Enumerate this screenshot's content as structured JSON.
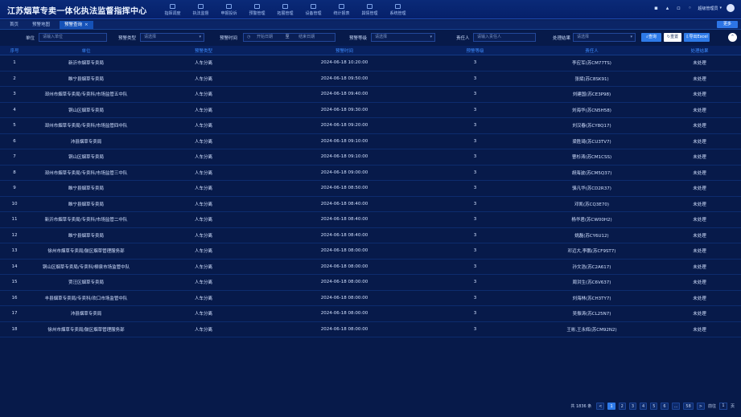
{
  "app": {
    "title": "江苏烟草专卖一体化执法监督指挥中心"
  },
  "topnav": [
    {
      "label": "指挥调度",
      "icon": "dispatch-icon"
    },
    {
      "label": "执法监督",
      "icon": "law-enforcement-icon"
    },
    {
      "label": "申报投诉",
      "icon": "complaint-icon"
    },
    {
      "label": "预警管理",
      "icon": "warning-icon"
    },
    {
      "label": "拓展管理",
      "icon": "extension-icon"
    },
    {
      "label": "设备管理",
      "icon": "device-icon"
    },
    {
      "label": "统计报表",
      "icon": "report-icon"
    },
    {
      "label": "舆情管理",
      "icon": "opinion-icon"
    },
    {
      "label": "系统管理",
      "icon": "system-icon"
    }
  ],
  "header": {
    "user_name": "超级管理员"
  },
  "tabs": [
    {
      "label": "首页"
    },
    {
      "label": "预警地图"
    },
    {
      "label": "预警查询",
      "close": "×"
    }
  ],
  "more_button": "更多",
  "filters": {
    "unit_label": "单位",
    "unit_placeholder": "请输入单位",
    "type_label": "预警类型",
    "type_placeholder": "请选择",
    "time_label": "预警时间",
    "start_placeholder": "开始日期",
    "range_sep": "至",
    "end_placeholder": "结束日期",
    "level_label": "预警等级",
    "level_placeholder": "请选择",
    "person_label": "责任人",
    "person_placeholder": "请输入责任人",
    "result_label": "处理结果",
    "result_placeholder": "请选择",
    "search_label": "查询",
    "reset_label": "重置",
    "export_label": "导出Excel",
    "collapse_label": "^"
  },
  "table": {
    "columns": [
      "序号",
      "单位",
      "预警类型",
      "预警时间",
      "预警等级",
      "责任人",
      "处理结果"
    ],
    "rows": [
      [
        "1",
        "新沂市烟草专卖局",
        "人车分离",
        "2024-06-18 10:20:00",
        "3",
        "李应军(苏CM77TS)",
        "未处理"
      ],
      [
        "2",
        "睢宁县烟草专卖局",
        "人车分离",
        "2024-06-18 09:50:00",
        "3",
        "张斌(苏C8SK91)",
        "未处理"
      ],
      [
        "3",
        "邳州市烟草专卖局/专卖科/市场监管五中队",
        "人车分离",
        "2024-06-18 09:40:00",
        "3",
        "刘建国(苏CE3P98)",
        "未处理"
      ],
      [
        "4",
        "铜山区烟草专卖局",
        "人车分离",
        "2024-06-18 09:30:00",
        "3",
        "刘海华(苏CN5H58)",
        "未处理"
      ],
      [
        "5",
        "邳州市烟草专卖局/专卖科/市场监管四中队",
        "人车分离",
        "2024-06-18 09:20:00",
        "3",
        "刘汉春(苏CY8Q17)",
        "未处理"
      ],
      [
        "6",
        "沛县烟草专卖局",
        "人车分离",
        "2024-06-18 09:10:00",
        "3",
        "梁胜琦(苏CU3TV7)",
        "未处理"
      ],
      [
        "7",
        "铜山区烟草专卖局",
        "人车分离",
        "2024-06-18 09:10:00",
        "3",
        "曹杉涛(苏CM1CSS)",
        "未处理"
      ],
      [
        "8",
        "邳州市烟草专卖局/专卖科/市场监管三中队",
        "人车分离",
        "2024-06-18 09:00:00",
        "3",
        "胡海波(苏CM5Q37)",
        "未处理"
      ],
      [
        "9",
        "睢宁县烟草专卖局",
        "人车分离",
        "2024-06-18 08:50:00",
        "3",
        "骆凡华(苏CD2R37)",
        "未处理"
      ],
      [
        "10",
        "睢宁县烟草专卖局",
        "人车分离",
        "2024-06-18 08:40:00",
        "3",
        "邓凯(苏CQ3E70)",
        "未处理"
      ],
      [
        "11",
        "新沂市烟草专卖局/专卖科/市场监管二中队",
        "人车分离",
        "2024-06-18 08:40:00",
        "3",
        "杨华君(苏CW00H2)",
        "未处理"
      ],
      [
        "12",
        "睢宁县烟草专卖局",
        "人车分离",
        "2024-06-18 08:40:00",
        "3",
        "姚磊(苏CY6U12)",
        "未处理"
      ],
      [
        "13",
        "徐州市烟草专卖局/鼓区烟草管理服务部",
        "人车分离",
        "2024-06-18 08:00:00",
        "3",
        "邓迈大,李鹏(苏CF9ST7)",
        "未处理"
      ],
      [
        "14",
        "铜山区烟草专卖局/专卖科/柳泉市场监管中队",
        "人车分离",
        "2024-06-18 08:00:00",
        "3",
        "孙文浩(苏C2A617)",
        "未处理"
      ],
      [
        "15",
        "贾汪区烟草专卖局",
        "人车分离",
        "2024-06-18 08:00:00",
        "3",
        "周洪生(苏C6V637)",
        "未处理"
      ],
      [
        "16",
        "丰县烟草专卖局/专卖科/欢口市场监管中队",
        "人车分离",
        "2024-06-18 08:00:00",
        "3",
        "刘海林(苏CH3TY7)",
        "未处理"
      ],
      [
        "17",
        "沛县烟草专卖局",
        "人车分离",
        "2024-06-18 08:00:00",
        "3",
        "吴振涛(苏CL25N7)",
        "未处理"
      ],
      [
        "18",
        "徐州市烟草专卖局/鼓区烟草管理服务部",
        "人车分离",
        "2024-06-18 08:00:00",
        "3",
        "王彬,王永辉(苏CM92N2)",
        "未处理"
      ]
    ]
  },
  "pagination": {
    "total": "共 1836 条",
    "prev": "<",
    "pages": [
      "1",
      "2",
      "3",
      "4",
      "5",
      "6",
      "...",
      "58"
    ],
    "active_page": "1",
    "next": ">",
    "goto_label": "前往",
    "goto_value": "1",
    "page_suffix": "页"
  },
  "colors": {
    "background": "#071a4a",
    "header": "#0a2a78",
    "accent": "#2e7ae8",
    "column_header_text": "#3e8cff"
  }
}
